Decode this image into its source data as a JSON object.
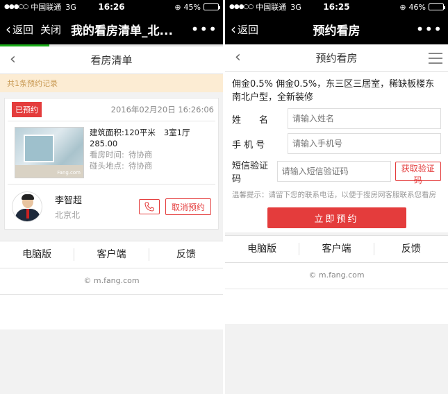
{
  "left": {
    "status": {
      "signal": "●●●○○",
      "carrier": "中国联通",
      "network": "3G",
      "time": "16:26",
      "battery": "45%",
      "battery_level": 0.45
    },
    "nav": {
      "back": "返回",
      "close": "关闭",
      "title": "我的看房清单_北...",
      "more": "•••"
    },
    "progress": 0.22,
    "page_title": "看房清单",
    "record_count_text": "共1条预约记录",
    "booking": {
      "status_badge": "已预约",
      "datetime": "2016年02月20日 16:26:06",
      "area": "建筑面积:120平米",
      "layout": "3室1厅",
      "price": "285.00",
      "visit_time_label": "看房时间:",
      "visit_time_value": "待协商",
      "meet_place_label": "碰头地点:",
      "meet_place_value": "待协商",
      "photo_watermark": "Fang.com"
    },
    "agent": {
      "name": "李智超",
      "city": "北京北"
    },
    "cancel_label": "取消预约",
    "footer": {
      "pc": "电脑版",
      "app": "客户端",
      "feedback": "反馈"
    },
    "copyright": "© m.fang.com"
  },
  "right": {
    "status": {
      "signal": "●●●○○",
      "carrier": "中国联通",
      "network": "3G",
      "time": "16:25",
      "battery": "46%",
      "battery_level": 0.46
    },
    "nav": {
      "back": "返回",
      "title": "预约看房",
      "more": "•••"
    },
    "page_title": "预约看房",
    "listing_title": "佣金0.5% 佣金0.5%，东三区三居室，稀缺板楼东南北户型，全新装修",
    "form": {
      "name_label": "姓　　名",
      "name_placeholder": "请输入姓名",
      "phone_label": "手 机 号",
      "phone_placeholder": "请输入手机号",
      "code_label": "短信验证码",
      "code_placeholder": "请输入短信验证码",
      "get_code": "获取验证码",
      "tip": "温馨提示：请留下您的联系电话，以便于搜房网客服联系您看房",
      "submit": "立即预约"
    },
    "footer": {
      "pc": "电脑版",
      "app": "客户端",
      "feedback": "反馈"
    },
    "copyright": "© m.fang.com"
  },
  "colors": {
    "accent": "#e43c3c",
    "progress": "#1aad19",
    "notice_bg": "#fcecd3"
  }
}
